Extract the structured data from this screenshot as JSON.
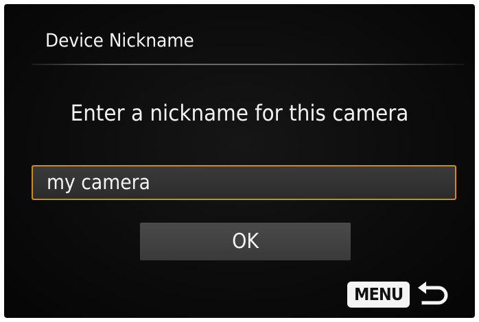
{
  "header": {
    "title": "Device Nickname"
  },
  "main": {
    "prompt": "Enter a nickname for this camera",
    "nickname_field": {
      "value": "my camera"
    },
    "ok_label": "OK"
  },
  "footer": {
    "menu_label": "MENU",
    "return_icon": "return-arrow-icon"
  },
  "colors": {
    "field_border": "#d98a14",
    "background": "#0c0c0c",
    "button_bg": "#444444",
    "text": "#f2f2f2"
  }
}
